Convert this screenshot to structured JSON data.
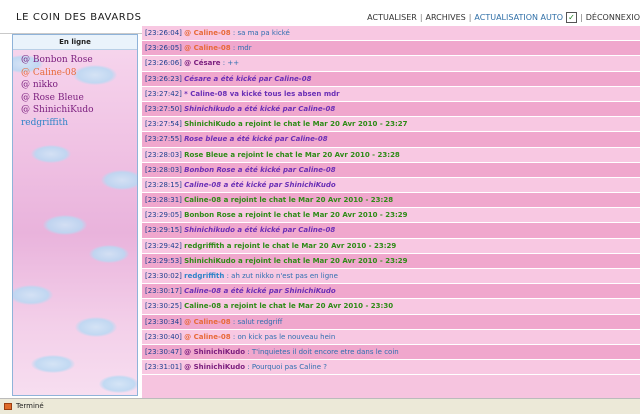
{
  "header": {
    "title": "LE COIN DES BAVARDS",
    "menu": {
      "refresh": "ACTUALISER",
      "archives": "ARCHIVES",
      "auto": "ACTUALISATION AUTO",
      "logout": "DÉCONNEXIO"
    }
  },
  "sidebar": {
    "heading": "En ligne",
    "users": [
      {
        "label": "@ Bonbon Rose",
        "color": "#7b1e7e"
      },
      {
        "label": "@ Caline-08",
        "color": "#e86a3a"
      },
      {
        "label": "@ nikko",
        "color": "#7b1e7e"
      },
      {
        "label": "@ Rose Bleue",
        "color": "#7b1e7e"
      },
      {
        "label": "@ ShinichiKudo",
        "color": "#7b1e7e"
      },
      {
        "label": "redgriffith",
        "color": "#2f84c8"
      }
    ]
  },
  "chat": {
    "messages": [
      {
        "time": "[23:26:04]",
        "nick": "@ Caline-08",
        "text": "sa ma pa kické",
        "type": "msg",
        "nickColor": "#e86a3a",
        "textColor": "#2f6fb0"
      },
      {
        "time": "[23:26:05]",
        "nick": "@ Caline-08",
        "text": "mdr",
        "type": "msg",
        "nickColor": "#e86a3a",
        "textColor": "#2f6fb0"
      },
      {
        "time": "[23:26:06]",
        "nick": "@ Césare",
        "text": "++",
        "type": "msg",
        "nickColor": "#7b1e7e",
        "textColor": "#2f6fb0"
      },
      {
        "time": "[23:26:23]",
        "nick": "",
        "text": "Césare a été kické par Caline-08",
        "type": "kick",
        "textColor": "#6a2fb5"
      },
      {
        "time": "[23:27:42]",
        "nick": "",
        "text": "* Caline-08 va kické tous les absen mdr",
        "type": "action",
        "textColor": "#6a2fb5"
      },
      {
        "time": "[23:27:50]",
        "nick": "",
        "text": "Shinichikudo a été kické par Caline-08",
        "type": "kick",
        "textColor": "#6a2fb5"
      },
      {
        "time": "[23:27:54]",
        "nick": "",
        "text": "ShinichiKudo a rejoint le chat le Mar 20 Avr 2010 - 23:27",
        "type": "join",
        "textColor": "#2e8b17"
      },
      {
        "time": "[23:27:55]",
        "nick": "",
        "text": "Rose bleue a été kické par Caline-08",
        "type": "kick",
        "textColor": "#6a2fb5"
      },
      {
        "time": "[23:28:03]",
        "nick": "",
        "text": "Rose Bleue a rejoint le chat le Mar 20 Avr 2010 - 23:28",
        "type": "join",
        "textColor": "#2e8b17"
      },
      {
        "time": "[23:28:03]",
        "nick": "",
        "text": "Bonbon Rose a été kické par Caline-08",
        "type": "kick",
        "textColor": "#6a2fb5"
      },
      {
        "time": "[23:28:15]",
        "nick": "",
        "text": "Caline-08 a été kické par ShinichiKudo",
        "type": "kick",
        "textColor": "#6a2fb5"
      },
      {
        "time": "[23:28:31]",
        "nick": "",
        "text": "Caline-08 a rejoint le chat le Mar 20 Avr 2010 - 23:28",
        "type": "join",
        "textColor": "#2e8b17"
      },
      {
        "time": "[23:29:05]",
        "nick": "",
        "text": "Bonbon Rose a rejoint le chat le Mar 20 Avr 2010 - 23:29",
        "type": "join",
        "textColor": "#2e8b17"
      },
      {
        "time": "[23:29:15]",
        "nick": "",
        "text": "Shinichikudo a été kické par Caline-08",
        "type": "kick",
        "textColor": "#6a2fb5"
      },
      {
        "time": "[23:29:42]",
        "nick": "",
        "text": "redgriffith a rejoint le chat le Mar 20 Avr 2010 - 23:29",
        "type": "join",
        "textColor": "#2e8b17"
      },
      {
        "time": "[23:29:53]",
        "nick": "",
        "text": "ShinichiKudo a rejoint le chat le Mar 20 Avr 2010 - 23:29",
        "type": "join",
        "textColor": "#2e8b17"
      },
      {
        "time": "[23:30:02]",
        "nick": "redgriffith",
        "text": "ah zut nikko n'est pas en ligne",
        "type": "msg",
        "nickColor": "#2f84c8",
        "textColor": "#2f6fb0"
      },
      {
        "time": "[23:30:17]",
        "nick": "",
        "text": "Caline-08 a été kické par ShinichiKudo",
        "type": "kick",
        "textColor": "#6a2fb5"
      },
      {
        "time": "[23:30:25]",
        "nick": "",
        "text": "Caline-08 a rejoint le chat le Mar 20 Avr 2010 - 23:30",
        "type": "join",
        "textColor": "#2e8b17"
      },
      {
        "time": "[23:30:34]",
        "nick": "@ Caline-08",
        "text": "salut redgriff",
        "type": "msg",
        "nickColor": "#e86a3a",
        "textColor": "#2f6fb0"
      },
      {
        "time": "[23:30:40]",
        "nick": "@ Caline-08",
        "text": "on kick pas le nouveau hein",
        "type": "msg",
        "nickColor": "#e86a3a",
        "textColor": "#2f6fb0"
      },
      {
        "time": "[23:30:47]",
        "nick": "@ ShinichiKudo",
        "text": "T'inquietes il doit encore etre dans le coin",
        "type": "msg",
        "nickColor": "#7b1e7e",
        "textColor": "#2f6fb0"
      },
      {
        "time": "[23:31:01]",
        "nick": "@ ShinichiKudo",
        "text": "Pourquoi pas Caline ?",
        "type": "msg",
        "nickColor": "#7b1e7e",
        "textColor": "#2f6fb0"
      }
    ]
  },
  "statusbar": {
    "text": "Terminé"
  }
}
